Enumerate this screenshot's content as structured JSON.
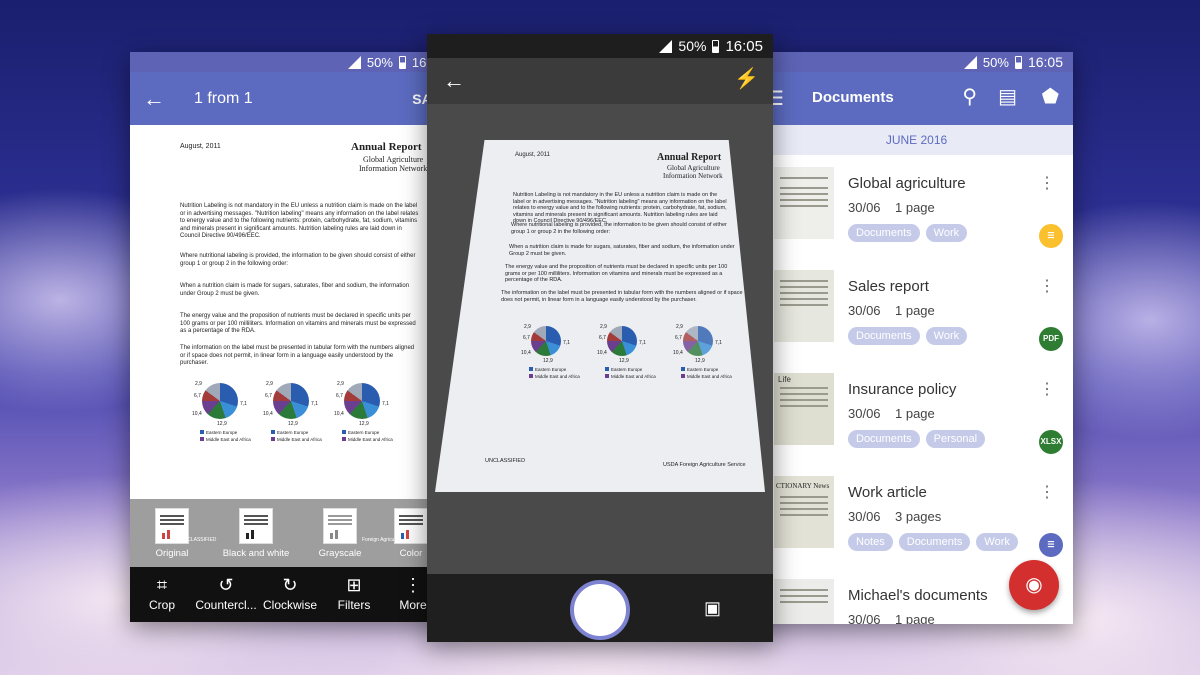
{
  "left_phone": {
    "status": {
      "battery": "50%",
      "time": "16:"
    },
    "appbar": {
      "title": "1 from 1",
      "action": "SAV"
    },
    "filters": [
      "Original",
      "Black and white",
      "Grayscale",
      "Color"
    ],
    "thumb_labels": {
      "unclassified": "UNCLASSIFIED",
      "foreign": "Foreign Agricu"
    },
    "tools": [
      {
        "label": "Crop",
        "icon": "crop-icon"
      },
      {
        "label": "Countercl...",
        "icon": "rotate-left-icon"
      },
      {
        "label": "Clockwise",
        "icon": "rotate-right-icon"
      },
      {
        "label": "Filters",
        "icon": "filters-icon"
      },
      {
        "label": "More",
        "icon": "more-vert-icon"
      }
    ]
  },
  "document": {
    "date": "August, 2011",
    "title": "Annual Report",
    "subtitle1": "Global Agriculture",
    "subtitle2": "Information Network",
    "p1": "Nutrition Labeling is not mandatory in the EU unless a nutrition claim is made on the label or in advertising messages. \"Nutrition labeling\" means any information on the label relates to energy value and to the following nutrients: protein, carbohydrate, fat, sodium, vitamins and minerals present in significant amounts. Nutrition labeling rules are laid down in Council Directive 90/496/EEC.",
    "p2": "Where nutritional labeling is provided, the information to be given should consist of either group 1 or group 2 in the following order:",
    "p3": "When a nutrition claim is made for sugars, saturates, fiber and sodium, the information under Group 2 must be given.",
    "p4": "The energy value and the proposition of nutrients must be declared in specific units per 100 grams or per 100 milliliters. Information on vitamins and minerals must be expressed as a percentage of the RDA.",
    "p5": "The information on the label must be presented in tabular form with the numbers aligned or if space does not permit, in linear form in a language easily understood by the purchaser.",
    "pie_labels": {
      "a": "2,9",
      "b": "6,7",
      "c": "10,4",
      "d": "12,9",
      "e": "7,1"
    },
    "legend": {
      "l1": "Eastern Europe",
      "l2": "Middle East and Africa"
    },
    "footer_left": "UNCLASSIFIED",
    "footer_right": "USDA Foreign Agriculture Service"
  },
  "center_phone": {
    "status": {
      "battery": "50%",
      "time": "16:05"
    }
  },
  "right_phone": {
    "status": {
      "battery": "50%",
      "time": "16:05"
    },
    "appbar": {
      "title": "Documents"
    },
    "month": "JUNE 2016",
    "docs": [
      {
        "name": "Global agriculture",
        "date": "30/06",
        "pages": "1 page",
        "tags": [
          "Documents",
          "Work"
        ],
        "type": "",
        "type_color": "#fbc02d"
      },
      {
        "name": "Sales report",
        "date": "30/06",
        "pages": "1 page",
        "tags": [
          "Documents",
          "Work"
        ],
        "type": "PDF",
        "type_color": "#2e7d32"
      },
      {
        "name": "Insurance policy",
        "date": "30/06",
        "pages": "1 page",
        "tags": [
          "Documents",
          "Personal"
        ],
        "type": "XLSX",
        "type_color": "#2e7d32"
      },
      {
        "name": "Work article",
        "date": "30/06",
        "pages": "3 pages",
        "tags": [
          "Notes",
          "Documents",
          "Work"
        ],
        "type": "",
        "type_color": "#5c6bc0"
      },
      {
        "name": "Michael's documents",
        "date": "30/06",
        "pages": "1 page",
        "tags": [],
        "type": "",
        "type_color": ""
      }
    ],
    "thumb_texts": {
      "t3": "Life",
      "t4": "CTIONARY News"
    }
  }
}
